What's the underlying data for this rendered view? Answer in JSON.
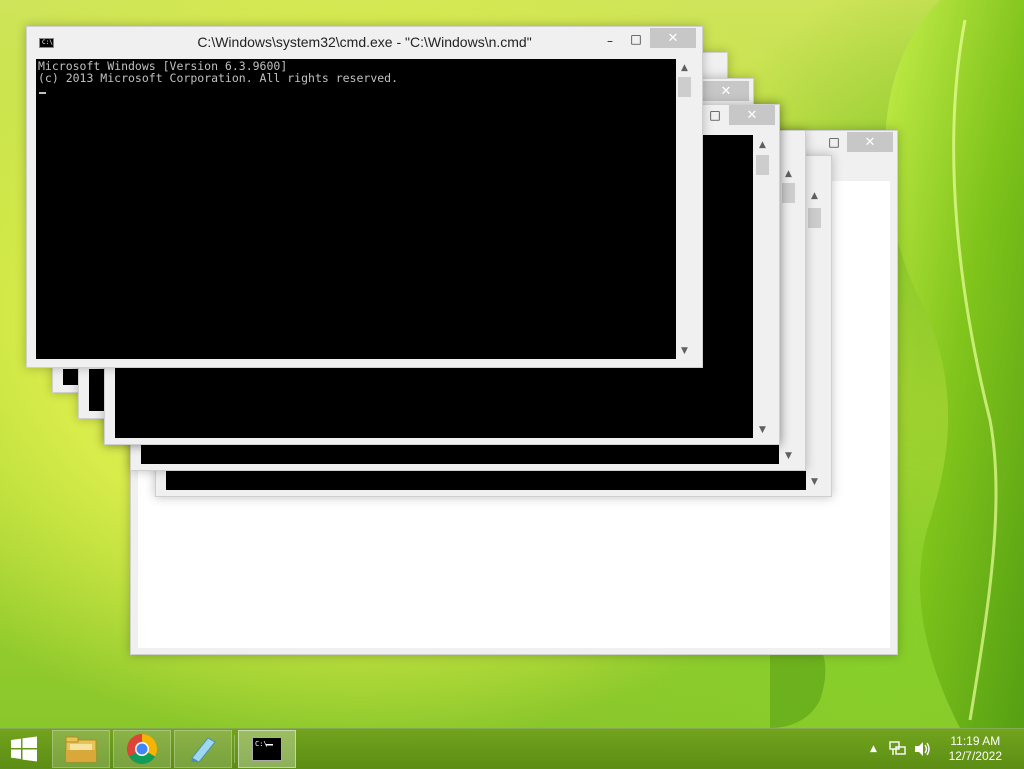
{
  "desktop": {
    "wallpaper": "green-leaf",
    "accent": "#86c52a"
  },
  "main_window": {
    "title": "C:\\Windows\\system32\\cmd.exe - \"C:\\Windows\\n.cmd\"",
    "console_lines": [
      "Microsoft Windows [Version 6.3.9600]",
      "(c) 2013 Microsoft Corporation. All rights reserved."
    ],
    "minimize_label": "–",
    "maximize_label": "□",
    "close_label": "✕"
  },
  "background_windows_count": 4,
  "taskbar": {
    "items": [
      {
        "name": "start",
        "icon": "windows-logo-icon"
      },
      {
        "name": "file-explorer",
        "icon": "folder-icon"
      },
      {
        "name": "chrome",
        "icon": "chrome-icon"
      },
      {
        "name": "app",
        "icon": "notepad-icon"
      },
      {
        "name": "cmd",
        "icon": "cmd-icon",
        "active": true
      }
    ],
    "tray": {
      "show_hidden_icon": "up-arrow-icon",
      "network_icon": "network-icon",
      "volume_icon": "speaker-icon"
    },
    "clock": {
      "time": "11:19 AM",
      "date": "12/7/2022"
    }
  }
}
